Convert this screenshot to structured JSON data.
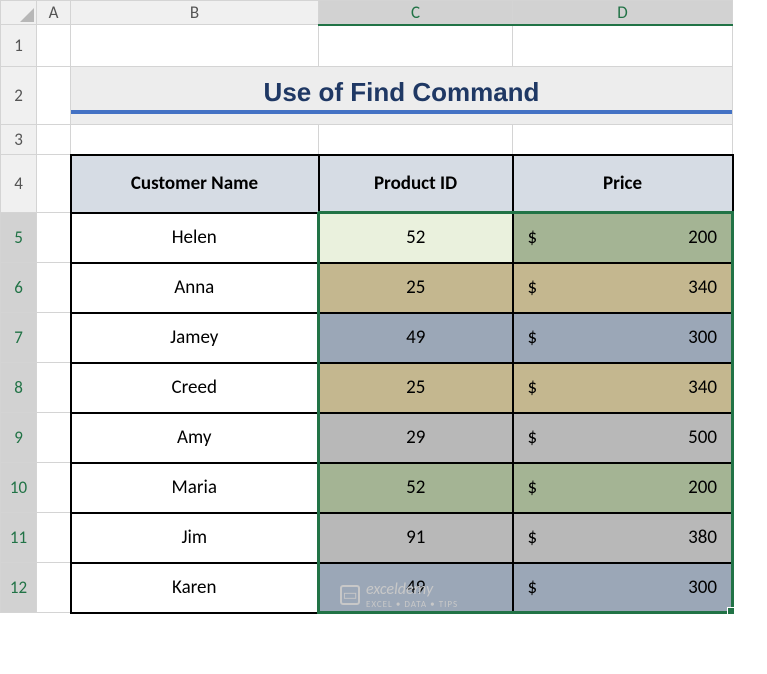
{
  "columns": {
    "A": "A",
    "B": "B",
    "C": "C",
    "D": "D"
  },
  "rows": [
    "1",
    "2",
    "3",
    "4",
    "5",
    "6",
    "7",
    "8",
    "9",
    "10",
    "11",
    "12"
  ],
  "title": "Use of Find Command",
  "headers": {
    "name": "Customer Name",
    "pid": "Product ID",
    "price": "Price"
  },
  "data": [
    {
      "name": "Helen",
      "pid": "52",
      "currency": "$",
      "price": "200",
      "fill": "fill-active",
      "pfill": "fill-olive"
    },
    {
      "name": "Anna",
      "pid": "25",
      "currency": "$",
      "price": "340",
      "fill": "fill-tan",
      "pfill": "fill-tan"
    },
    {
      "name": "Jamey",
      "pid": "49",
      "currency": "$",
      "price": "300",
      "fill": "fill-blue",
      "pfill": "fill-blue"
    },
    {
      "name": "Creed",
      "pid": "25",
      "currency": "$",
      "price": "340",
      "fill": "fill-tan",
      "pfill": "fill-tan"
    },
    {
      "name": "Amy",
      "pid": "29",
      "currency": "$",
      "price": "500",
      "fill": "fill-grey",
      "pfill": "fill-grey"
    },
    {
      "name": "Maria",
      "pid": "52",
      "currency": "$",
      "price": "200",
      "fill": "fill-olive",
      "pfill": "fill-olive"
    },
    {
      "name": "Jim",
      "pid": "91",
      "currency": "$",
      "price": "380",
      "fill": "fill-grey",
      "pfill": "fill-grey"
    },
    {
      "name": "Karen",
      "pid": "49",
      "currency": "$",
      "price": "300",
      "fill": "fill-blue",
      "pfill": "fill-blue"
    }
  ],
  "watermark": {
    "main": "exceldemy",
    "sub": "EXCEL • DATA • TIPS"
  },
  "chart_data": {
    "type": "table",
    "title": "Use of Find Command",
    "columns": [
      "Customer Name",
      "Product ID",
      "Price"
    ],
    "rows": [
      [
        "Helen",
        52,
        200
      ],
      [
        "Anna",
        25,
        340
      ],
      [
        "Jamey",
        49,
        300
      ],
      [
        "Creed",
        25,
        340
      ],
      [
        "Amy",
        29,
        500
      ],
      [
        "Maria",
        52,
        200
      ],
      [
        "Jim",
        91,
        380
      ],
      [
        "Karen",
        49,
        300
      ]
    ]
  }
}
